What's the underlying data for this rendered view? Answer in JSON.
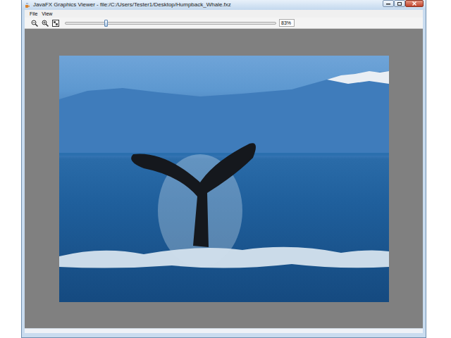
{
  "window": {
    "title": "JavaFX Graphics Viewer - file:/C:/Users/Tester1/Desktop/Humpback_Whale.fxz"
  },
  "menu": [
    {
      "label": "File"
    },
    {
      "label": "View"
    }
  ],
  "zoom": {
    "level": 0.19,
    "reading": "83%"
  }
}
